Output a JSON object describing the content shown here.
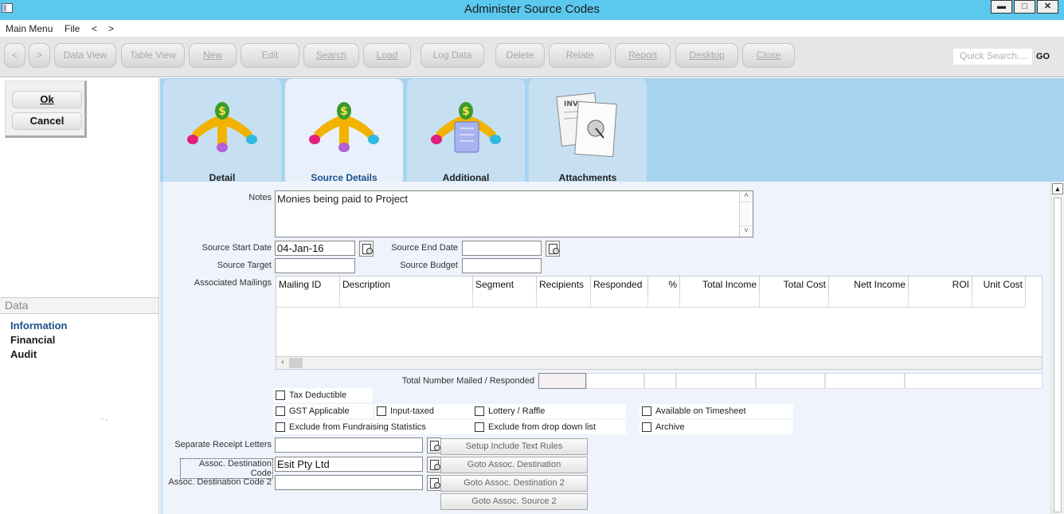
{
  "window": {
    "title": "Administer Source Codes",
    "minimize_glyph": "▬",
    "maximize_glyph": "□",
    "close_glyph": "✕"
  },
  "menubar": {
    "main_menu": "Main Menu",
    "file": "File",
    "back": "<",
    "forward": ">"
  },
  "toolbar": {
    "back": "<",
    "forward": ">",
    "buttons": [
      "Data View",
      "Table View",
      "New",
      "Edit",
      "Search",
      "Load",
      "Log Data",
      "Delete",
      "Relate",
      "Report",
      "Desktop",
      "Close"
    ],
    "quick_search_placeholder": "Quick Search....",
    "go_label": "GO"
  },
  "dialog": {
    "ok_label": "Ok",
    "cancel_label": "Cancel"
  },
  "side_nav": {
    "header": "Data",
    "items": [
      "Information",
      "Financial",
      "Audit"
    ],
    "active_color": "#1b4f8a"
  },
  "tabs": [
    "Detail",
    "Source Details",
    "Additional",
    "Attachments"
  ],
  "form": {
    "notes_label": "Notes",
    "notes_value": "Monies being paid to Project",
    "start_date_label": "Source Start Date",
    "start_date_value": "04-Jan-16",
    "end_date_label": "Source End Date",
    "end_date_value": "",
    "target_label": "Source Target",
    "target_value": "",
    "budget_label": "Source Budget",
    "budget_value": "",
    "mailings_label": "Associated Mailings",
    "mailings_columns": [
      "Mailing ID",
      "Description",
      "Segment",
      "Recipients",
      "Responded",
      "%",
      "Total Income",
      "Total Cost",
      "Nett Income",
      "ROI",
      "Unit Cost"
    ],
    "total_mailed_label": "Total Number Mailed / Responded",
    "checkboxes": {
      "tax_deductible": "Tax Deductible",
      "gst_applicable": "GST Applicable",
      "input_taxed": "Input-taxed",
      "lottery_raffle": "Lottery / Raffle",
      "available_timesheet": "Available on Timesheet",
      "exclude_fundraising": "Exclude from Fundraising Statistics",
      "exclude_dropdown": "Exclude from drop down list",
      "archive": "Archive"
    },
    "separate_receipt_label": "Separate Receipt Letters",
    "separate_receipt_value": "",
    "setup_include_button": "Setup Include Text Rules",
    "assoc_dest_label": "Assoc. Destination Code",
    "assoc_dest_value": "Esit Pty Ltd",
    "goto_assoc_dest_button": "Goto Assoc. Destination",
    "assoc_dest2_label": "Assoc. Destination Code 2",
    "assoc_dest2_value": "",
    "goto_assoc_dest2_button": "Goto Assoc. Destination 2",
    "goto_assoc_source2_button": "Goto Assoc. Source 2"
  }
}
